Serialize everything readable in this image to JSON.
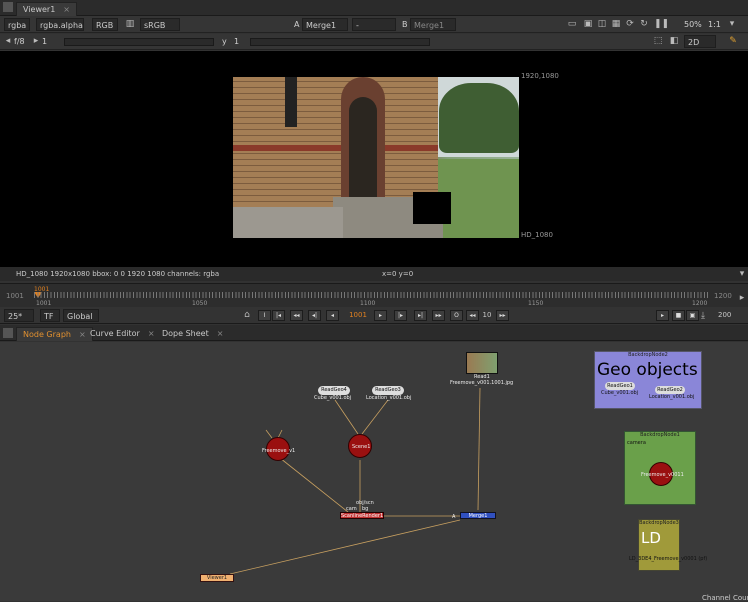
{
  "viewer_tab": {
    "label": "Viewer1",
    "close": "×"
  },
  "toolbar1": {
    "channels": "rgba",
    "alpha": "rgba.alpha",
    "colorspace": "RGB",
    "lut": "sRGB",
    "a_label": "A",
    "a_input": "Merge1",
    "mid": "-",
    "b_label": "B",
    "b_input": "Merge1",
    "zoom": "50%",
    "ratio": "1:1"
  },
  "toolbar2": {
    "fstop": "f/8",
    "gain": "1",
    "y_label": "y",
    "gamma": "1",
    "view_mode": "2D"
  },
  "viewer": {
    "res_top": "1920,1080",
    "res_bottom": "HD_1080",
    "info": "HD_1080 1920x1080  bbox: 0 0 1920 1080 channels: rgba",
    "coords": "x=0 y=0"
  },
  "timeline": {
    "start": "1001",
    "end": "1200",
    "current": "1001",
    "ticks": [
      "1001",
      "1050",
      "1100",
      "1150",
      "1200"
    ]
  },
  "playback": {
    "fps": "25*",
    "tf": "TF",
    "scope": "Global",
    "frame": "1001",
    "step": "10",
    "end_frame": "200"
  },
  "panel_tabs": [
    {
      "label": "Node Graph",
      "close": "×"
    },
    {
      "label": "Curve Editor",
      "close": "×"
    },
    {
      "label": "Dope Sheet",
      "close": "×"
    }
  ],
  "nodes": {
    "readgeo4": {
      "label": "ReadGeo4",
      "file": "Cube_v001.obj"
    },
    "readgeo3": {
      "label": "ReadGeo3",
      "file": "Location_v001.obj"
    },
    "read1": {
      "label": "Read1",
      "file": "Freemove_v001.1001.jpg"
    },
    "freemove": {
      "label": "Freemove_v1"
    },
    "scene": {
      "label": "Scene1"
    },
    "scanline": {
      "label": "ScanlineRender1",
      "inputs": "obj/scn",
      "cam": "cam",
      "bg": "bg"
    },
    "merge": {
      "label": "Merge1",
      "a": "A"
    },
    "viewer": {
      "label": "Viewer1"
    }
  },
  "backdrops": {
    "b2": {
      "header": "BackdropNode2",
      "title": "Geo objects",
      "n1": "ReadGeo1",
      "f1": "Cube_v001.obj",
      "n2": "ReadGeo2",
      "f2": "Location_v001.obj"
    },
    "b1": {
      "header": "BackdropNode1",
      "cam": "camera",
      "node": "Freemove_v0011"
    },
    "b3": {
      "header": "BackdropNode3",
      "title": "LD",
      "node": "LD_3DE4_Freemove_v0001 (pf)"
    }
  },
  "footer": {
    "channel_count": "Channel Coun"
  }
}
